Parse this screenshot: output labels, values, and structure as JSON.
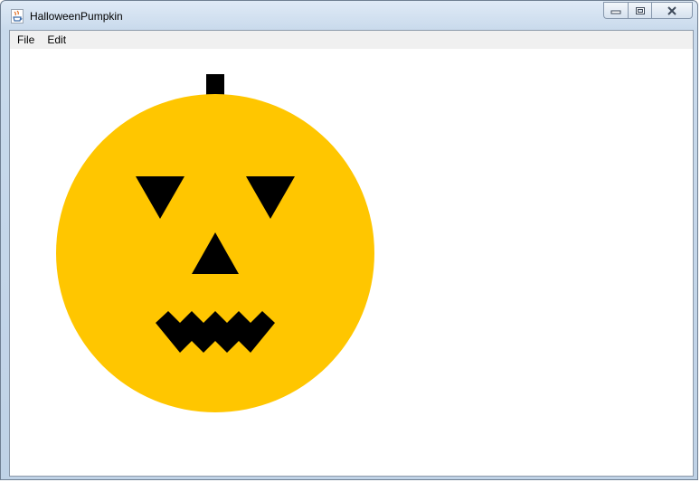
{
  "window": {
    "title": "HalloweenPumpkin",
    "icons": {
      "app": "java-cup-icon",
      "minimize": "minimize-icon",
      "maximize": "maximize-icon",
      "close": "close-icon"
    }
  },
  "menubar": {
    "items": [
      {
        "label": "File"
      },
      {
        "label": "Edit"
      }
    ]
  },
  "drawing": {
    "pumpkin_color": "#ffc600",
    "feature_color": "#000000",
    "shapes": [
      "stem",
      "pumpkin-body",
      "left-eye",
      "right-eye",
      "nose",
      "mouth"
    ]
  }
}
